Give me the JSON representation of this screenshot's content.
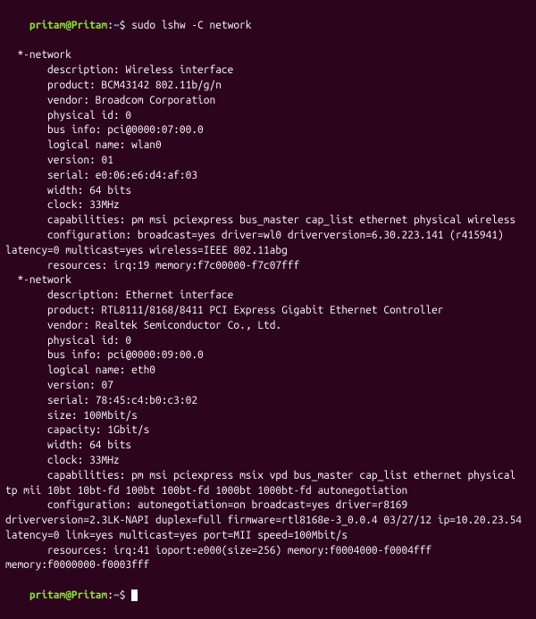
{
  "prompt": {
    "user_host": "pritam@Pritam",
    "separator": ":",
    "path": "~",
    "dollar": "$ "
  },
  "command": "sudo lshw -C network",
  "lines": [
    "  *-network",
    "       description: Wireless interface",
    "       product: BCM43142 802.11b/g/n",
    "       vendor: Broadcom Corporation",
    "       physical id: 0",
    "       bus info: pci@0000:07:00.0",
    "       logical name: wlan0",
    "       version: 01",
    "       serial: e0:06:e6:d4:af:03",
    "       width: 64 bits",
    "       clock: 33MHz",
    "       capabilities: pm msi pciexpress bus_master cap_list ethernet physical wireless",
    "       configuration: broadcast=yes driver=wl0 driverversion=6.30.223.141 (r415941) latency=0 multicast=yes wireless=IEEE 802.11abg",
    "       resources: irq:19 memory:f7c00000-f7c07fff",
    "  *-network",
    "       description: Ethernet interface",
    "       product: RTL8111/8168/8411 PCI Express Gigabit Ethernet Controller",
    "       vendor: Realtek Semiconductor Co., Ltd.",
    "       physical id: 0",
    "       bus info: pci@0000:09:00.0",
    "       logical name: eth0",
    "       version: 07",
    "       serial: 78:45:c4:b0:c3:02",
    "       size: 100Mbit/s",
    "       capacity: 1Gbit/s",
    "       width: 64 bits",
    "       clock: 33MHz",
    "       capabilities: pm msi pciexpress msix vpd bus_master cap_list ethernet physical tp mii 10bt 10bt-fd 100bt 100bt-fd 1000bt 1000bt-fd autonegotiation",
    "       configuration: autonegotiation=on broadcast=yes driver=r8169 driverversion=2.3LK-NAPI duplex=full firmware=rtl8168e-3_0.0.4 03/27/12 ip=10.20.23.54 latency=0 link=yes multicast=yes port=MII speed=100Mbit/s",
    "       resources: irq:41 ioport:e000(size=256) memory:f0004000-f0004fff memory:f0000000-f0003fff"
  ]
}
